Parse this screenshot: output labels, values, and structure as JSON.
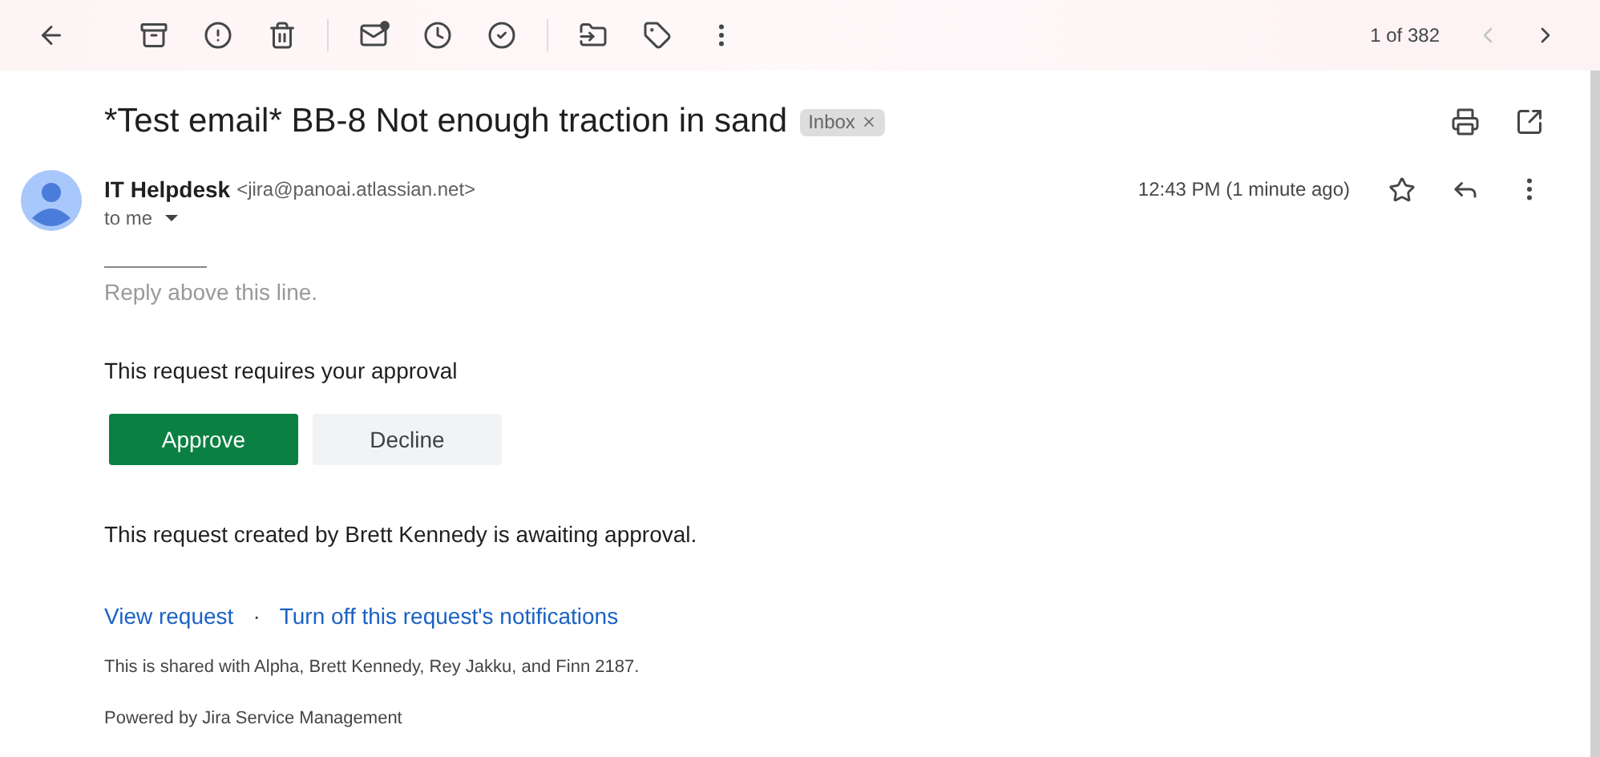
{
  "toolbar": {
    "counter": "1 of 382"
  },
  "message": {
    "subject": "*Test email* BB-8 Not enough traction in sand",
    "labels": [
      {
        "text": "Inbox"
      }
    ],
    "sender": {
      "name": "IT Helpdesk",
      "address": "<jira@panoai.atlassian.net>"
    },
    "recipient": "to me",
    "time": "12:43 PM (1 minute ago)",
    "starred": false
  },
  "body": {
    "reply_hint": "Reply above this line.",
    "prompt": "This request requires your approval",
    "buttons": [
      {
        "label": "Approve",
        "kind": "primary"
      },
      {
        "label": "Decline",
        "kind": "secondary"
      }
    ],
    "status": "This request created by Brett Kennedy is awaiting approval.",
    "links": [
      "View request",
      "Turn off this request's notifications"
    ],
    "link_separator": "·",
    "shared": "This is shared with Alpha, Brett Kennedy, Rey Jakku, and Finn 2187.",
    "footer": "Powered by Jira Service Management"
  }
}
